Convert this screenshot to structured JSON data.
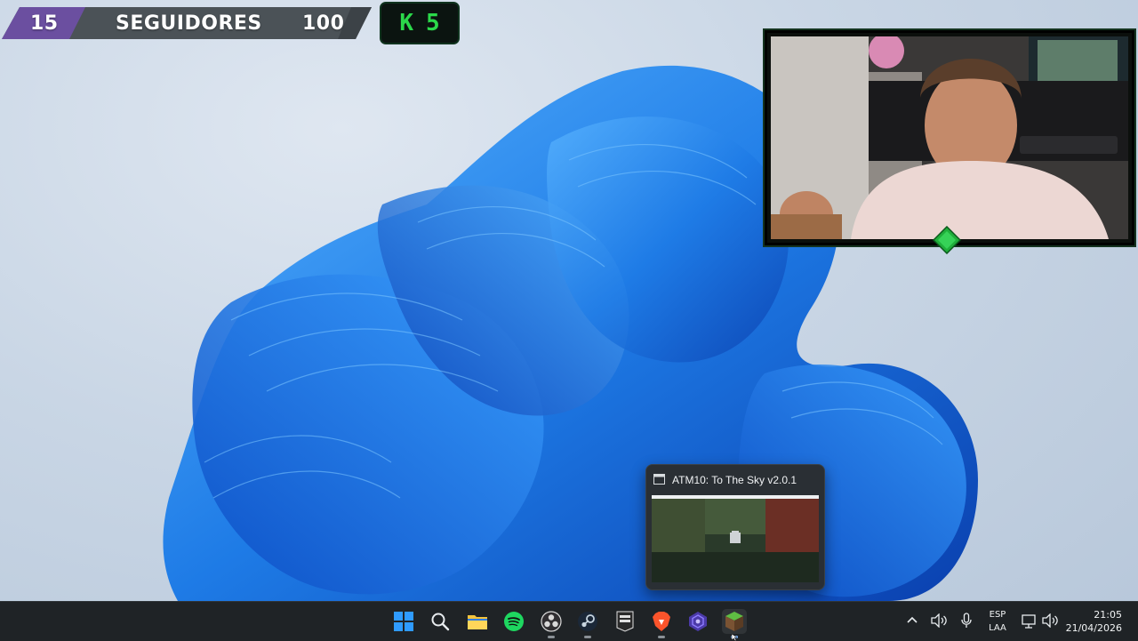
{
  "overlay": {
    "follower_current": "15",
    "follower_label": "SEGUIDORES",
    "follower_goal": "100",
    "k_label": "K",
    "k_value": "5"
  },
  "colors": {
    "accent_purple": "#6b4fa0",
    "accent_green": "#2bd94a",
    "taskbar_bg": "#1f2326",
    "wallpaper_blue": "#1e7be6"
  },
  "preview": {
    "title": "ATM10: To The Sky v2.0.1"
  },
  "taskbar": {
    "apps": [
      {
        "name": "start",
        "icon": "windows-logo-icon"
      },
      {
        "name": "search",
        "icon": "search-icon"
      },
      {
        "name": "file-explorer",
        "icon": "folder-icon"
      },
      {
        "name": "spotify",
        "icon": "spotify-icon"
      },
      {
        "name": "obs",
        "icon": "obs-icon"
      },
      {
        "name": "steam",
        "icon": "steam-icon"
      },
      {
        "name": "epic-games",
        "icon": "epic-games-icon",
        "label": "EPIC GAMES"
      },
      {
        "name": "brave",
        "icon": "brave-icon"
      },
      {
        "name": "app-purple",
        "icon": "purple-app-icon"
      },
      {
        "name": "minecraft-launcher",
        "icon": "minecraft-icon"
      }
    ]
  },
  "tray": {
    "language": "ESP",
    "layout": "LAA",
    "time": "21:05",
    "date": "21/04/2026"
  }
}
